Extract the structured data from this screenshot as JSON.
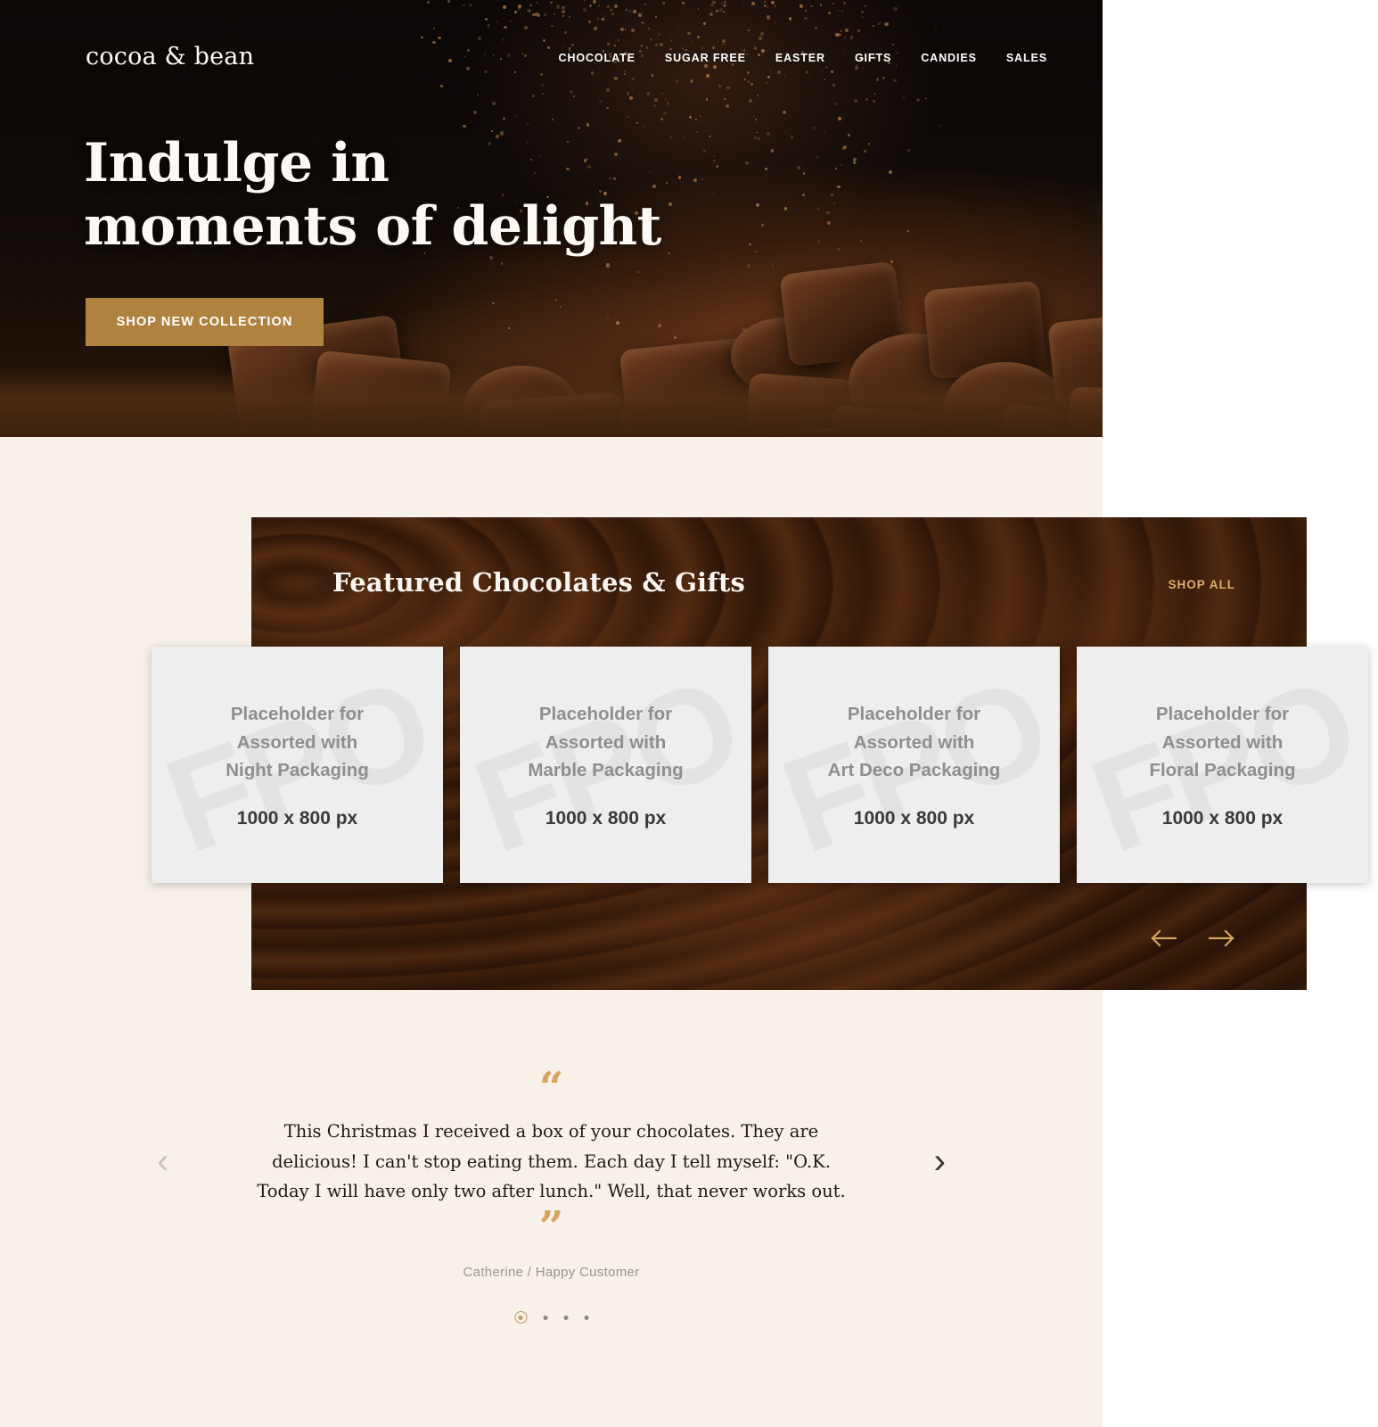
{
  "brand": {
    "logo": "cocoa & bean"
  },
  "nav": {
    "items": [
      {
        "label": "CHOCOLATE"
      },
      {
        "label": "SUGAR FREE"
      },
      {
        "label": "EASTER"
      },
      {
        "label": "GIFTS"
      },
      {
        "label": "CANDIES"
      },
      {
        "label": "SALES"
      }
    ]
  },
  "hero": {
    "title": "Indulge in\nmoments of delight",
    "cta_label": "SHOP NEW COLLECTION"
  },
  "featured": {
    "title": "Featured Chocolates & Gifts",
    "shop_all_label": "SHOP ALL",
    "prev_icon": "arrow-left-icon",
    "next_icon": "arrow-right-icon",
    "cards": [
      {
        "label": "Placeholder for\nAssorted with\nNight Packaging",
        "dims": "1000 x 800 px",
        "watermark": "FPO"
      },
      {
        "label": "Placeholder for\nAssorted with\nMarble Packaging",
        "dims": "1000 x 800 px",
        "watermark": "FPO"
      },
      {
        "label": "Placeholder for\nAssorted with\nArt Deco Packaging",
        "dims": "1000 x 800 px",
        "watermark": "FPO"
      },
      {
        "label": "Placeholder for\nAssorted with\nFloral Packaging",
        "dims": "1000 x 800 px",
        "watermark": "FPO"
      }
    ]
  },
  "testimonial": {
    "quote_open": "“",
    "quote_close": "”",
    "text": "This Christmas I received a box of your chocolates. They are delicious! I can't stop eating them. Each day I tell myself: \"O.K. Today I will have only two after lunch.\" Well, that never works out.",
    "author": "Catherine / Happy Customer",
    "prev_icon": "chevron-left-icon",
    "next_icon": "chevron-right-icon",
    "dots": [
      {
        "active": true
      },
      {
        "active": false
      },
      {
        "active": false
      },
      {
        "active": false
      }
    ]
  },
  "colors": {
    "accent_gold": "#b0823f",
    "accent_light_gold": "#dcae6a",
    "cream_bg": "#f7f1e9",
    "chocolate_brown": "#3b1d0c",
    "hero_dark": "#0a0708"
  }
}
